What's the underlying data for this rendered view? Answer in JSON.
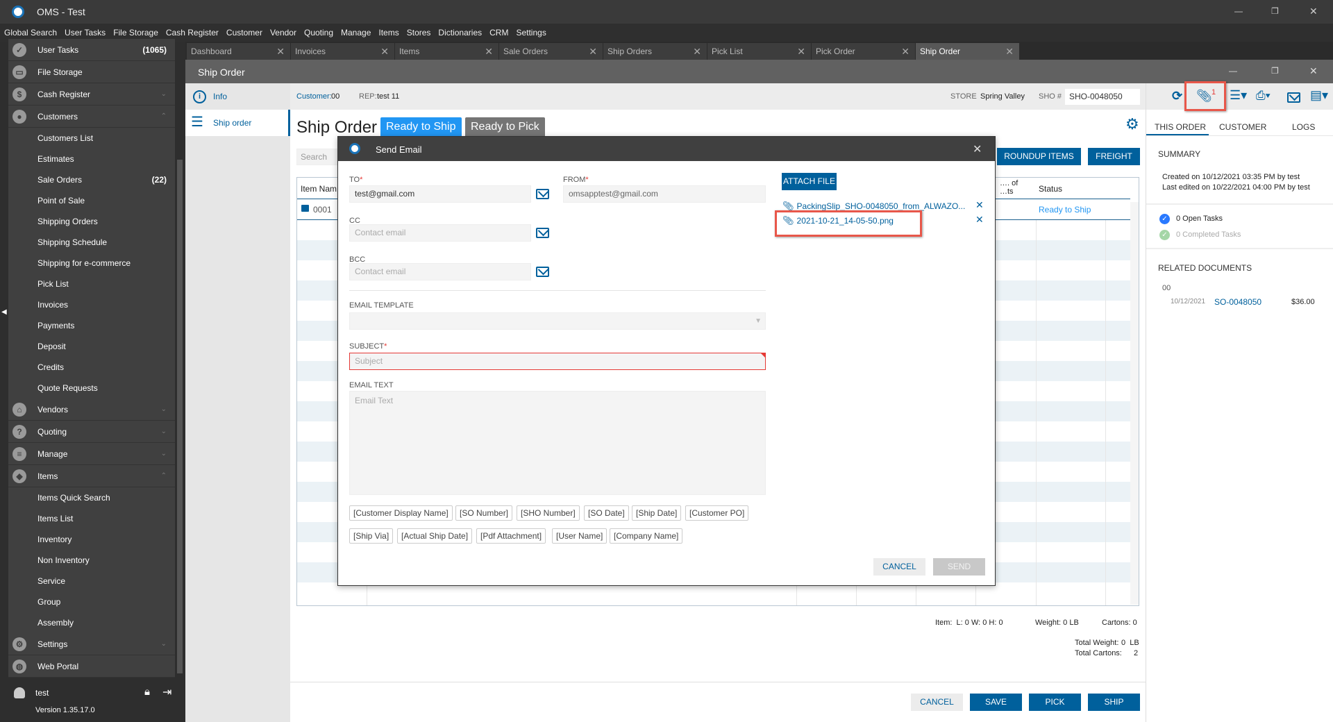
{
  "app": {
    "title": "OMS - Test",
    "window_controls": [
      "—",
      "❐",
      "✕"
    ]
  },
  "menu": [
    "Global Search",
    "User Tasks",
    "File Storage",
    "Cash Register",
    "Customer",
    "Vendor",
    "Quoting",
    "Manage",
    "Items",
    "Stores",
    "Dictionaries",
    "CRM",
    "Settings"
  ],
  "tabs": [
    {
      "label": "Dashboard",
      "active": false
    },
    {
      "label": "Invoices",
      "active": false
    },
    {
      "label": "Items",
      "active": false
    },
    {
      "label": "Sale Orders",
      "active": false
    },
    {
      "label": "Ship Orders",
      "active": false
    },
    {
      "label": "Pick List",
      "active": false
    },
    {
      "label": "Pick Order",
      "active": false
    },
    {
      "label": "Ship Order",
      "active": true
    }
  ],
  "sidebar": {
    "items": [
      {
        "label": "User Tasks",
        "type": "sec",
        "icon": "check-circle-icon",
        "glyph": "✓",
        "count": "(1065)"
      },
      {
        "label": "File Storage",
        "type": "sec",
        "icon": "folder-icon",
        "glyph": "▭"
      },
      {
        "label": "Cash Register",
        "type": "sec",
        "icon": "dollar-icon",
        "glyph": "$",
        "chevron": "⌄"
      },
      {
        "label": "Customers",
        "type": "sec",
        "icon": "person-icon",
        "glyph": "●",
        "chevron": "⌃"
      },
      {
        "label": "Customers List",
        "type": "sub"
      },
      {
        "label": "Estimates",
        "type": "sub"
      },
      {
        "label": "Sale Orders",
        "type": "sub",
        "count": "(22)"
      },
      {
        "label": "Point of Sale",
        "type": "sub"
      },
      {
        "label": "Shipping Orders",
        "type": "sub"
      },
      {
        "label": "Shipping Schedule",
        "type": "sub"
      },
      {
        "label": "Shipping for e-commerce",
        "type": "sub"
      },
      {
        "label": "Pick List",
        "type": "sub"
      },
      {
        "label": "Invoices",
        "type": "sub"
      },
      {
        "label": "Payments",
        "type": "sub"
      },
      {
        "label": "Deposit",
        "type": "sub"
      },
      {
        "label": "Credits",
        "type": "sub"
      },
      {
        "label": "Quote Requests",
        "type": "sub"
      },
      {
        "label": "Vendors",
        "type": "sec",
        "icon": "store-icon",
        "glyph": "⌂",
        "chevron": "⌄"
      },
      {
        "label": "Quoting",
        "type": "sec",
        "icon": "question-clipboard-icon",
        "glyph": "?",
        "chevron": "⌄"
      },
      {
        "label": "Manage",
        "type": "sec",
        "icon": "clipboard-icon",
        "glyph": "≡",
        "chevron": "⌄"
      },
      {
        "label": "Items",
        "type": "sec",
        "icon": "tag-icon",
        "glyph": "◆",
        "chevron": "⌃"
      },
      {
        "label": "Items Quick Search",
        "type": "sub"
      },
      {
        "label": "Items List",
        "type": "sub"
      },
      {
        "label": "Inventory",
        "type": "sub"
      },
      {
        "label": "Non Inventory",
        "type": "sub"
      },
      {
        "label": "Service",
        "type": "sub"
      },
      {
        "label": "Group",
        "type": "sub"
      },
      {
        "label": "Assembly",
        "type": "sub"
      },
      {
        "label": "Settings",
        "type": "sec",
        "icon": "gear-icon",
        "glyph": "⚙",
        "chevron": "⌄"
      },
      {
        "label": "Web Portal",
        "type": "sec",
        "icon": "globe-icon",
        "glyph": "◍"
      }
    ],
    "user": "test",
    "version": "Version 1.35.17.0"
  },
  "window": {
    "title": "Ship Order"
  },
  "leftnav": {
    "info": "Info",
    "ship_order": "Ship order"
  },
  "header": {
    "customer_label": "Customer:",
    "customer_value": "00",
    "rep_label": "REP:",
    "rep_value": "test 11",
    "store_label": "STORE",
    "store_value": "Spring Valley",
    "sho_label": "SHO #",
    "sho_value": "SHO-0048050",
    "attachment_count": "1"
  },
  "main": {
    "title": "Ship Order",
    "badge_ship": "Ready to Ship",
    "badge_pick": "Ready to Pick",
    "search_placeholder": "Search",
    "roundup": "ROUNDUP ITEMS",
    "freight": "FREIGHT",
    "table": {
      "headers": {
        "item_name": "Item Nam",
        "units": "…. of\n…ts",
        "status": "Status"
      },
      "rows": [
        {
          "item": "0001",
          "status": "Ready to Ship"
        }
      ]
    },
    "footer": {
      "item_dims": "Item:  L: 0 W: 0 H: 0",
      "weight": "Weight: 0 LB",
      "cartons": "Cartons: 0",
      "total_weight_label": "Total Weight:",
      "total_weight_value": "0  LB",
      "total_cartons_label": "Total Cartons:",
      "total_cartons_value": "2"
    },
    "buttons": {
      "cancel": "CANCEL",
      "save": "SAVE",
      "pick": "PICK",
      "ship": "SHIP"
    }
  },
  "right": {
    "tabs": [
      "THIS ORDER",
      "CUSTOMER",
      "LOGS"
    ],
    "summary_title": "SUMMARY",
    "created": "Created on 10/12/2021 03:35 PM by test",
    "edited": "Last edited on 10/22/2021 04:00 PM by test",
    "open_tasks": "0 Open Tasks",
    "completed_tasks": "0 Completed Tasks",
    "related_title": "RELATED DOCUMENTS",
    "related_group": "00",
    "related": [
      {
        "date": "10/12/2021",
        "doc": "SO-0048050",
        "amount": "$36.00"
      }
    ]
  },
  "dialog": {
    "title": "Send Email",
    "to_label": "TO",
    "to_value": "test@gmail.com",
    "from_label": "FROM",
    "from_value": "omsapptest@gmail.com",
    "cc_label": "CC",
    "cc_placeholder": "Contact email",
    "bcc_label": "BCC",
    "bcc_placeholder": "Contact email",
    "template_label": "EMAIL TEMPLATE",
    "subject_label": "SUBJECT",
    "subject_placeholder": "Subject",
    "text_label": "EMAIL TEXT",
    "text_placeholder": "Email Text",
    "tokens": [
      [
        "[Customer Display Name]",
        "[SO Number]",
        "[SHO Number]",
        "[SO Date]",
        "[Ship Date]",
        "[Customer PO]"
      ],
      [
        "[Ship Via]",
        "[Actual Ship Date]",
        "[Pdf Attachment]",
        "[User Name]",
        "[Company Name]"
      ]
    ],
    "attach_button": "ATTACH FILE",
    "attachments": [
      "PackingSlip_SHO-0048050_from_ALWAZO...",
      "2021-10-21_14-05-50.png"
    ],
    "cancel": "CANCEL",
    "send": "SEND",
    "required_mark": "*"
  },
  "colors": {
    "accent": "#00609c",
    "badge_ship": "#2196f3",
    "badge_pick": "#757575",
    "highlight": "#e8574a"
  }
}
